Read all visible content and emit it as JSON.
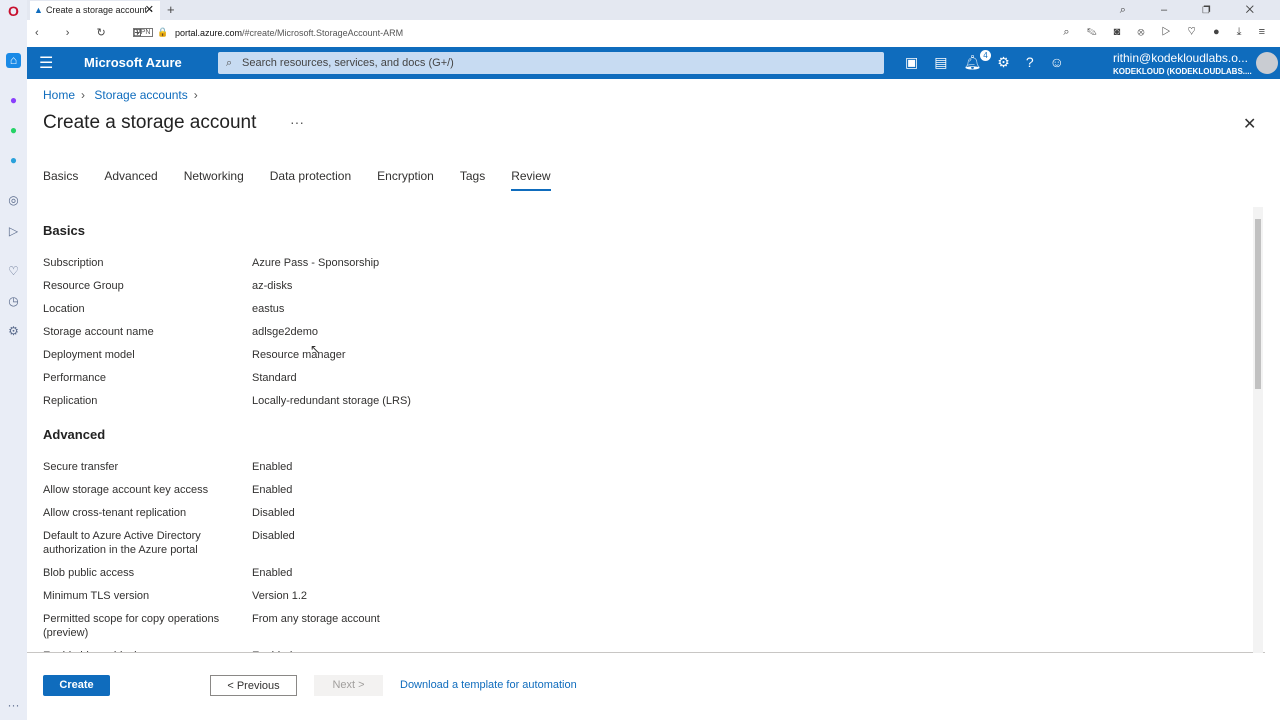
{
  "browser": {
    "tab_title": "Create a storage account -",
    "url_host": "portal.azure.com",
    "url_path": "/#create/Microsoft.StorageAccount-ARM",
    "vpn": "VPN"
  },
  "header": {
    "brand": "Microsoft Azure",
    "search_placeholder": "Search resources, services, and docs (G+/)",
    "notification_count": "4",
    "user_email": "rithin@kodekloudlabs.o...",
    "user_tenant": "KODEKLOUD (KODEKLOUDLABS...."
  },
  "breadcrumb": [
    "Home",
    "Storage accounts"
  ],
  "page": {
    "title": "Create a storage account",
    "more": "···"
  },
  "tabs": [
    "Basics",
    "Advanced",
    "Networking",
    "Data protection",
    "Encryption",
    "Tags",
    "Review"
  ],
  "active_tab": "Review",
  "sections": [
    {
      "title": "Basics",
      "rows": [
        [
          "Subscription",
          "Azure Pass - Sponsorship"
        ],
        [
          "Resource Group",
          "az-disks"
        ],
        [
          "Location",
          "eastus"
        ],
        [
          "Storage account name",
          "adlsge2demo"
        ],
        [
          "Deployment model",
          "Resource manager"
        ],
        [
          "Performance",
          "Standard"
        ],
        [
          "Replication",
          "Locally-redundant storage (LRS)"
        ]
      ]
    },
    {
      "title": "Advanced",
      "rows": [
        [
          "Secure transfer",
          "Enabled"
        ],
        [
          "Allow storage account key access",
          "Enabled"
        ],
        [
          "Allow cross-tenant replication",
          "Disabled"
        ],
        [
          "Default to Azure Active Directory authorization in the Azure portal",
          "Disabled"
        ],
        [
          "Blob public access",
          "Enabled"
        ],
        [
          "Minimum TLS version",
          "Version 1.2"
        ],
        [
          "Permitted scope for copy operations (preview)",
          "From any storage account"
        ],
        [
          "Enable hierarchical namespace",
          "Enabled"
        ]
      ]
    }
  ],
  "footer": {
    "create": "Create",
    "previous": "< Previous",
    "next": "Next >",
    "download": "Download a template for automation"
  },
  "colors": {
    "accent": "#0f6cbd"
  }
}
